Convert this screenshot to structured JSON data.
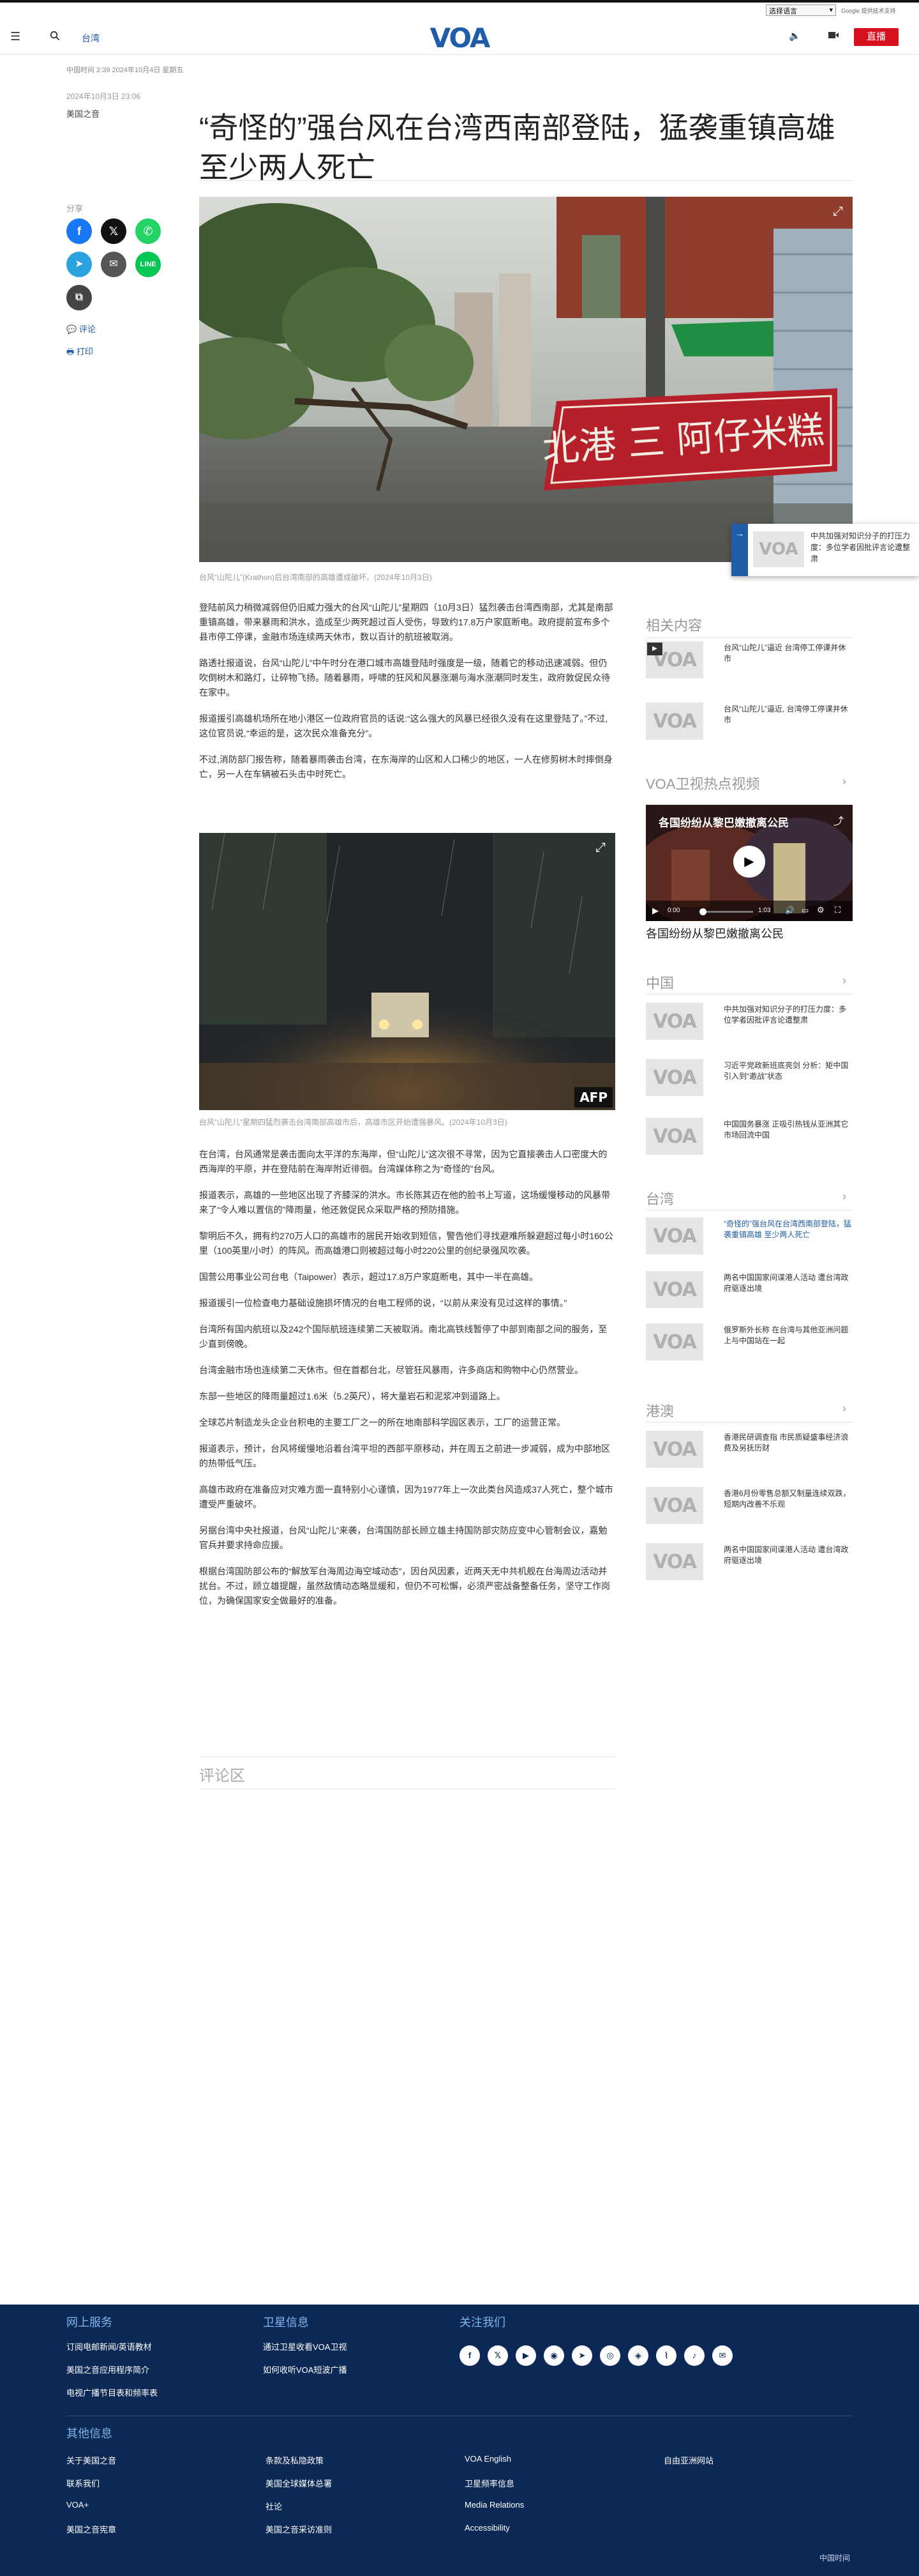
{
  "top": {
    "language_select": "选择语言",
    "google_translate": "Google 翻译",
    "google_word": "Google",
    "translate_powered": "提供技术支持"
  },
  "header": {
    "section": "台湾",
    "logo": "VOA",
    "live": "直播"
  },
  "article": {
    "meta": "中国时间 2:39 2024年10月4日 星期五",
    "date": "2024年10月3日 23:06",
    "author": "美国之音",
    "title": "“奇怪的”强台风在台湾西南部登陆，猛袭重镇高雄 至少两人死亡",
    "hero_caption": "台风“山陀儿”(Krathon)后台湾南部的高雄遭成破坏。(2024年10月3日)",
    "hero_sign_text": "北港 三 阿仔米糕",
    "photo2_caption": "台风“山陀儿”星期四猛烈袭击台湾南部高雄市后，高雄市区开始遭强暴风。(2024年10月3日)",
    "photo2_credit": "AFP",
    "paragraphs": [
      "登陆前风力稍微减弱但仍旧威力强大的台风“山陀儿”星期四（10月3日）猛烈袭击台湾西南部，尤其是南部重镇高雄，带来暴雨和洪水，造成至少两死超过百人受伤，导致约17.8万户家庭断电。政府提前宣布多个县市停工停课，金融市场连续两天休市，数以百计的航班被取消。",
      "路透社报道说，台风“山陀儿”中午时分在港口城市高雄登陆时强度是一级，随着它的移动迅速减弱。但仍吹倒树木和路灯，让碎物飞扬。随着暴雨，呼啸的狂风和风暴涨潮与海水涨潮同时发生，政府敦促民众待在家中。",
      "报道援引高雄机场所在地小港区一位政府官员的话说:“这么强大的风暴已经很久没有在这里登陆了。”不过,这位官员说,“幸运的是，这次民众准备充分”。",
      "不过,消防部门报告称，随着暴雨袭击台湾，在东海岸的山区和人口稀少的地区，一人在修剪树木时摔倒身亡，另一人在车辆被石头击中时死亡。",
      "在台湾，台风通常是袭击面向太平洋的东海岸，但“山陀儿”这次很不寻常，因为它直接袭击人口密度大的西海岸的平原，并在登陆前在海岸附近徘徊。台湾媒体称之为“奇怪的”台风。",
      "报道表示，高雄的一些地区出现了齐膝深的洪水。市长陈其迈在他的脸书上写道，这场缓慢移动的风暴带来了“令人难以置信的”降雨量，他还敦促民众采取严格的预防措施。",
      "黎明后不久，拥有约270万人口的高雄市的居民开始收到短信，警告他们寻找避难所躲避超过每小时160公里（100英里/小时）的阵风。而高雄港口则被超过每小时220公里的创纪录强风吹袭。",
      "国营公用事业公司台电（Taipower）表示，超过17.8万户家庭断电，其中一半在高雄。",
      "报道援引一位检查电力基础设施损坏情况的台电工程师的说，“以前从来没有见过这样的事情。”",
      "台湾所有国内航班以及242个国际航班连续第二天被取消。南北高铁线暂停了中部到南部之间的服务，至少直到傍晚。",
      "台湾金融市场也连续第二天休市。但在首都台北，尽管狂风暴雨，许多商店和购物中心仍然营业。",
      "东部一些地区的降雨量超过1.6米（5.2英尺），将大量岩石和泥浆冲到道路上。",
      "全球芯片制造龙头企业台积电的主要工厂之一的所在地南部科学园区表示，工厂的运营正常。",
      "报道表示，预计，台风将缓慢地沿着台湾平坦的西部平原移动，并在周五之前进一步减弱，成为中部地区的热带低气压。",
      "高雄市政府在准备应对灾难方面一直特别小心谨慎，因为1977年上一次此类台风造成37人死亡，整个城市遭受严重破坏。",
      "另据台湾中央社报道，台风“山陀儿”来袭，台湾国防部长顾立雄主持国防部灾防应变中心管制会议，嘉勉官兵并要求持命应援。",
      "根据台湾国防部公布的“解放军台海周边海空域动态”，因台风因素，近两天无中共机舰在台海周边活动并扰台。不过，顾立雄提醒，虽然敌情动态略显缓和，但仍不可松懈，必须严密战备整备任务，坚守工作岗位，为确保国家安全做最好的准备。"
    ],
    "comments": "评论区"
  },
  "share": {
    "label": "分享",
    "comments": "评论",
    "print": "打印"
  },
  "popup": {
    "text": "中共加强对知识分子的打压力度：多位学者因批评言论遭整肃"
  },
  "sidebar": {
    "related": {
      "title": "相关内容",
      "items": [
        "台风“山陀儿”逼近 台湾停工停课并休市",
        "台风“山陀儿”逼近, 台湾停工停课并休市"
      ]
    },
    "videos": {
      "title": "VOA卫视热点视频",
      "video_title": "各国纷纷从黎巴嫩撤离公民",
      "time_current": "0:00",
      "time_total": "1:03",
      "caption": "各国纷纷从黎巴嫩撤离公民",
      "progress": 0
    },
    "china": {
      "title": "中国",
      "items": [
        "中共加强对知识分子的打压力度：多位学者因批评言论遭整肃",
        "习近平党政新班底亮剑 分析：矩中国引入到“邀战”状态",
        "中国国务暴涨 正吸引热钱从亚洲其它市场回流中国"
      ]
    },
    "taiwan": {
      "title": "台湾",
      "items": [
        "“奇怪的”强台风在台湾西南部登陆，猛袭重镇高雄 至少两人死亡",
        "两名中国国家间谍港人活动 遭台湾政府驱逐出境",
        "俄罗斯外长称 在台湾与其他亚洲问题上与中国站在一起"
      ]
    },
    "hongkong": {
      "title": "港澳",
      "items": [
        "香港民研调查指 市民质疑盛事经济浪费及另抚历财",
        "香港6月份零售总额又制量连续双跌，短期内改善不乐观",
        "两名中国国家间谍港人活动 遭台湾政府驱逐出境"
      ]
    }
  },
  "footer": {
    "col1": {
      "title": "网上服务",
      "links": [
        "订阅电邮新闻/英语教材",
        "美国之音应用程序简介",
        "电视广播节目表和频率表"
      ]
    },
    "col2": {
      "title": "卫星信息",
      "links": [
        "通过卫星收看VOA卫视",
        "如何收听VOA短波广播"
      ]
    },
    "col3": {
      "title": "关注我们"
    },
    "other": {
      "title": "其他信息",
      "links": [
        "关于美国之音",
        "条款及私隐政策",
        "VOA English",
        "自由亚洲网站",
        "联系我们",
        "美国全球媒体总署",
        "卫星频率信息",
        "",
        "VOA+",
        "社论",
        "Media Relations",
        "",
        "美国之音宪章",
        "美国之音采访准则",
        "Accessibility",
        ""
      ]
    },
    "bottom": "中国时间"
  }
}
